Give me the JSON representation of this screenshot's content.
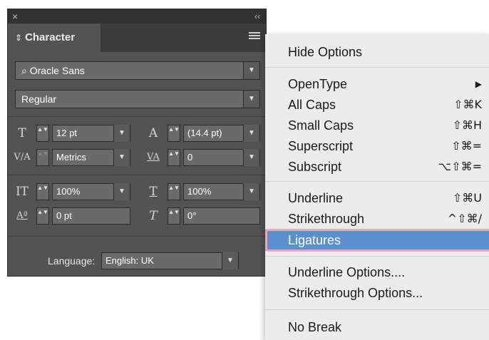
{
  "panel": {
    "close_glyph": "×",
    "collapse_glyph": "‹‹",
    "tab_updown_glyph": "⇕",
    "tab_title": "Character",
    "font_family": "Oracle Sans",
    "font_style": "Regular",
    "font_size": "12 pt",
    "leading": "(14.4 pt)",
    "kerning": "Metrics",
    "tracking": "0",
    "vertical_scale": "100%",
    "horizontal_scale": "100%",
    "baseline_shift": "0 pt",
    "skew": "0°",
    "language_label": "Language:",
    "language_value": "English: UK"
  },
  "icons": {
    "font_size": "T",
    "leading": "A",
    "kerning": "V/A",
    "tracking": "VA",
    "vertical_scale": "IT",
    "horizontal_scale": "T",
    "baseline_shift": "Aª",
    "skew": "T",
    "arrow": "▼",
    "spin": "▲▼",
    "search": "⌕"
  },
  "menu": {
    "items": [
      {
        "label": "Hide Options",
        "shortcut": ""
      },
      {
        "label": "OpenType",
        "shortcut": "▶"
      },
      {
        "label": "All Caps",
        "shortcut": "⇧⌘K"
      },
      {
        "label": "Small Caps",
        "shortcut": "⇧⌘H"
      },
      {
        "label": "Superscript",
        "shortcut": "⇧⌘="
      },
      {
        "label": "Subscript",
        "shortcut": "⌥⇧⌘="
      },
      {
        "label": "Underline",
        "shortcut": "⇧⌘U"
      },
      {
        "label": "Strikethrough",
        "shortcut": "^⇧⌘/"
      },
      {
        "label": "Ligatures",
        "shortcut": ""
      },
      {
        "label": "Underline Options....",
        "shortcut": ""
      },
      {
        "label": "Strikethrough Options...",
        "shortcut": ""
      },
      {
        "label": "No Break",
        "shortcut": ""
      }
    ]
  },
  "colors": {
    "panel_bg": "#535353",
    "menu_bg": "#ececec",
    "highlight": "#5d8fd0",
    "highlight_outline": "#f1a6b3"
  }
}
